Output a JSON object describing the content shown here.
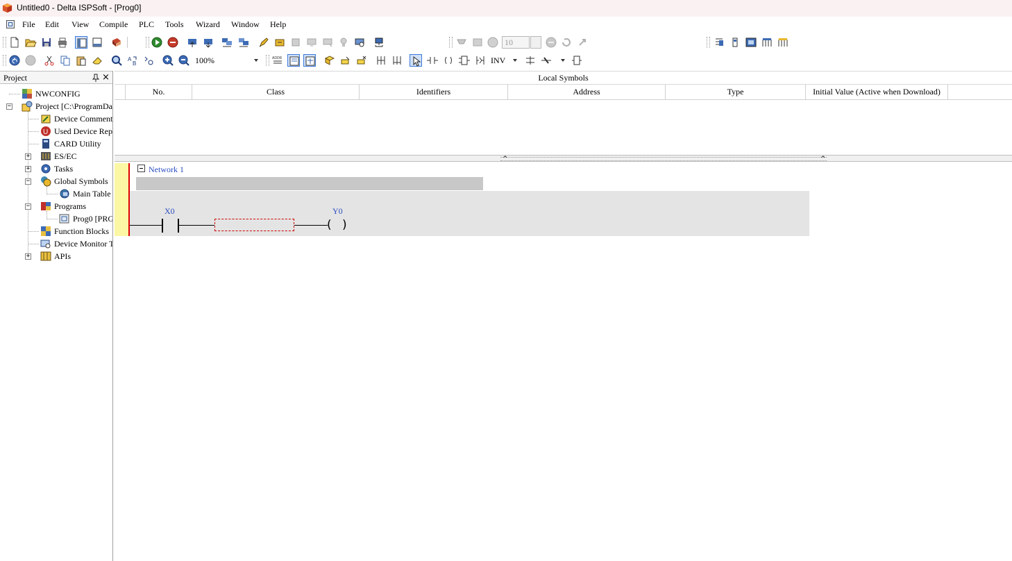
{
  "window": {
    "title": "Untitled0 - Delta ISPSoft - [Prog0]"
  },
  "menu": {
    "items": [
      "File",
      "Edit",
      "View",
      "Compile",
      "PLC",
      "Tools",
      "Wizard",
      "Window",
      "Help"
    ]
  },
  "toolbar": {
    "scan_value": "10",
    "zoom_value": "100%",
    "inv_label": "INV"
  },
  "project_panel": {
    "title": "Project",
    "tree": [
      {
        "label": "NWCONFIG",
        "icon": "nwconfig-icon"
      },
      {
        "label": "Project [C:\\ProgramDa",
        "icon": "project-icon"
      },
      {
        "label": "Device Comment",
        "icon": "device-comment-icon"
      },
      {
        "label": "Used Device Rep",
        "icon": "used-device-icon"
      },
      {
        "label": "CARD Utility",
        "icon": "card-utility-icon"
      },
      {
        "label": "ES/EC",
        "icon": "esec-icon"
      },
      {
        "label": "Tasks",
        "icon": "tasks-icon"
      },
      {
        "label": "Global Symbols",
        "icon": "global-symbols-icon"
      },
      {
        "label": "Main Table",
        "icon": "main-table-icon"
      },
      {
        "label": "Programs",
        "icon": "programs-icon"
      },
      {
        "label": "Prog0 [PRG",
        "icon": "prog-icon"
      },
      {
        "label": "Function Blocks",
        "icon": "function-blocks-icon"
      },
      {
        "label": "Device Monitor T",
        "icon": "device-monitor-icon"
      },
      {
        "label": "APIs",
        "icon": "apis-icon"
      }
    ]
  },
  "local_symbols": {
    "title": "Local Symbols",
    "columns": [
      "No.",
      "Class",
      "Identifiers",
      "Address",
      "Type",
      "Initial Value (Active when Download)"
    ]
  },
  "ladder": {
    "network_label": "Network 1",
    "contact_label": "X0",
    "coil_label": "Y0"
  },
  "colors": {
    "title_bg": "#faf1f2",
    "rung_rail": "#e00000",
    "rung_marker": "#fbf7a5",
    "device_label": "#2a4dc0"
  }
}
